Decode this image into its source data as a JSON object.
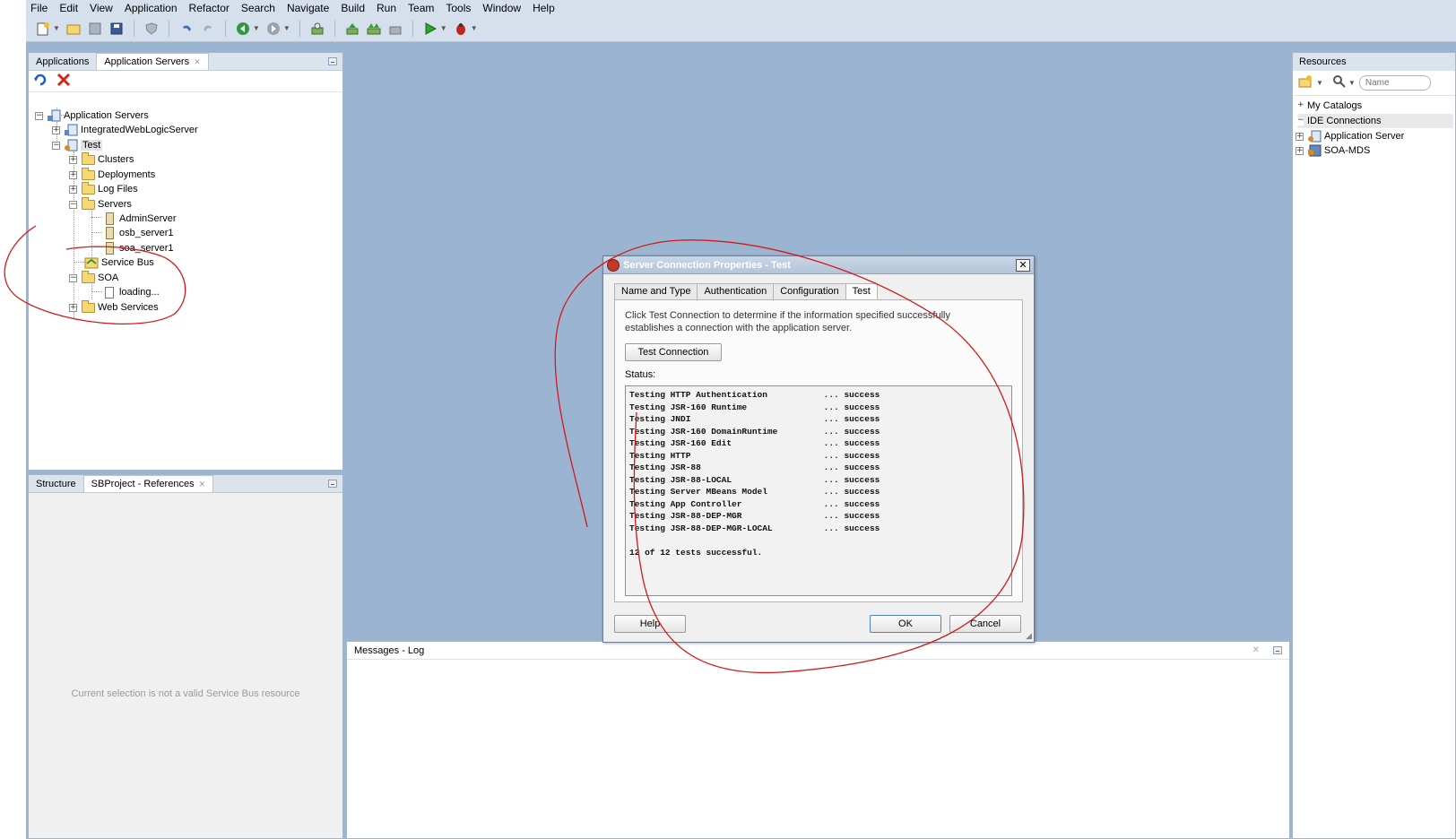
{
  "menu": [
    "File",
    "Edit",
    "View",
    "Application",
    "Refactor",
    "Search",
    "Navigate",
    "Build",
    "Run",
    "Team",
    "Tools",
    "Window",
    "Help"
  ],
  "toolbar_icons": [
    "new-icon",
    "open-icon",
    "save-icon",
    "save-all-icon",
    "shield-icon",
    "undo-icon",
    "redo-icon",
    "back-icon",
    "forward-icon",
    "deploy-icon",
    "make-icon",
    "rebuild-icon",
    "build-icon",
    "run-icon",
    "debug-icon"
  ],
  "left_panel": {
    "tabs": [
      "Applications",
      "Application Servers"
    ],
    "tree": {
      "root": "Application Servers",
      "integrated": "IntegratedWebLogicServer",
      "test": "Test",
      "clusters": "Clusters",
      "deployments": "Deployments",
      "log_files": "Log Files",
      "servers": "Servers",
      "admin_server": "AdminServer",
      "osb_server": "osb_server1",
      "soa_server": "soa_server1",
      "service_bus": "Service Bus",
      "soa": "SOA",
      "loading": "loading...",
      "web_services": "Web Services"
    }
  },
  "structure_panel": {
    "tabs": [
      "Structure",
      "SBProject - References"
    ],
    "message": "Current selection is not a valid Service Bus resource"
  },
  "messages_panel": {
    "title": "Messages - Log"
  },
  "resources_panel": {
    "title": "Resources",
    "search_placeholder": "Name",
    "my_catalogs": "My Catalogs",
    "ide_connections": "IDE Connections",
    "application_server": "Application Server",
    "soa_mds": "SOA-MDS"
  },
  "dialog": {
    "title": "Server Connection Properties - Test",
    "tabs": [
      "Name and Type",
      "Authentication",
      "Configuration",
      "Test"
    ],
    "description": "Click Test Connection to determine if the information specified successfully establishes a connection with the application server.",
    "test_button": "Test Connection",
    "status_label": "Status:",
    "status_lines": [
      "Testing HTTP Authentication           ... success",
      "Testing JSR-160 Runtime               ... success",
      "Testing JNDI                          ... success",
      "Testing JSR-160 DomainRuntime         ... success",
      "Testing JSR-160 Edit                  ... success",
      "Testing HTTP                          ... success",
      "Testing JSR-88                        ... success",
      "Testing JSR-88-LOCAL                  ... success",
      "Testing Server MBeans Model           ... success",
      "Testing App Controller                ... success",
      "Testing JSR-88-DEP-MGR                ... success",
      "Testing JSR-88-DEP-MGR-LOCAL          ... success",
      "",
      "12 of 12 tests successful."
    ],
    "help_button": "Help",
    "ok_button": "OK",
    "cancel_button": "Cancel"
  }
}
